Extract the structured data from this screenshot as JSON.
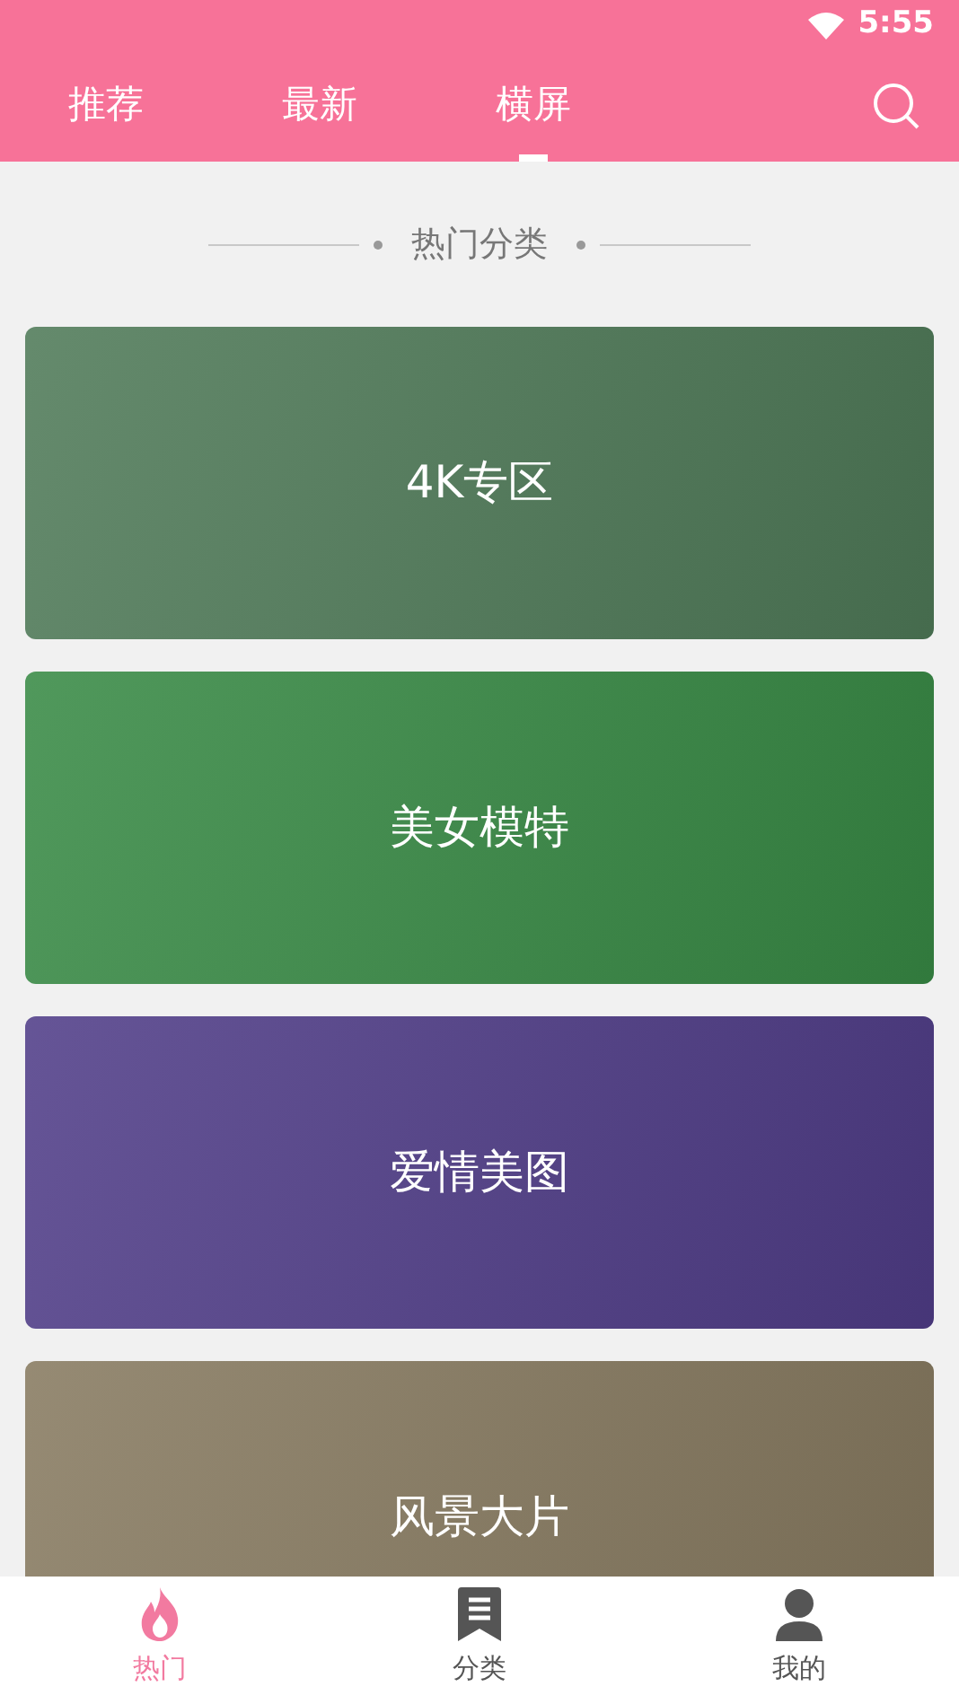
{
  "status_bar": {
    "time": "5:55"
  },
  "tabs": [
    {
      "label": "推荐",
      "selected": false
    },
    {
      "label": "最新",
      "selected": false
    },
    {
      "label": "横屏",
      "selected": true
    }
  ],
  "section_title": "热门分类",
  "categories": [
    {
      "label": "4K专区",
      "color": "#4f7a58"
    },
    {
      "label": "美女模特",
      "color": "#388a45"
    },
    {
      "label": "爱情美图",
      "color": "#503d88"
    },
    {
      "label": "风景大片",
      "color": "#877a60"
    }
  ],
  "bottom_nav": [
    {
      "label": "热门",
      "kind": "flame",
      "selected": true
    },
    {
      "label": "分类",
      "kind": "bookmark",
      "selected": false
    },
    {
      "label": "我的",
      "kind": "person",
      "selected": false
    }
  ]
}
